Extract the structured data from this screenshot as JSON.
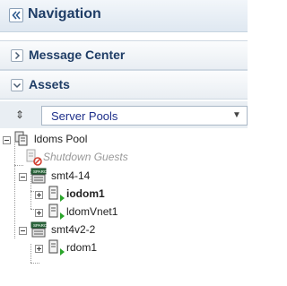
{
  "nav": {
    "title": "Navigation",
    "collapse_icon": "double-chevron-left-icon"
  },
  "sections": {
    "message_center": {
      "label": "Message Center",
      "state": "collapsed",
      "icon": "chevron-right-icon"
    },
    "assets": {
      "label": "Assets",
      "state": "expanded",
      "icon": "chevron-down-icon"
    }
  },
  "selector": {
    "value": "Server Pools",
    "sort_icon": "sort-icon",
    "caret_icon": "caret-down-icon"
  },
  "tree": {
    "pool": {
      "label": "ldoms Pool",
      "icon": "server-pool-icon"
    },
    "shutdown": {
      "label": "Shutdown Guests",
      "icon": "server-stopped-icon"
    },
    "hosts": [
      {
        "label": "smt4-14",
        "icon": "sparc-server-icon",
        "children": [
          {
            "label": "iodom1",
            "icon": "vm-running-icon"
          },
          {
            "label": "ldomVnet1",
            "icon": "vm-running-icon"
          }
        ]
      },
      {
        "label": "smt4v2-2",
        "icon": "sparc-server-icon",
        "children": [
          {
            "label": "rdom1",
            "icon": "vm-running-icon"
          }
        ]
      }
    ]
  },
  "colors": {
    "accent": "#1f3d66",
    "link": "#1d2f8a",
    "running": "#2aa52a",
    "stopped": "#d23c2c"
  }
}
